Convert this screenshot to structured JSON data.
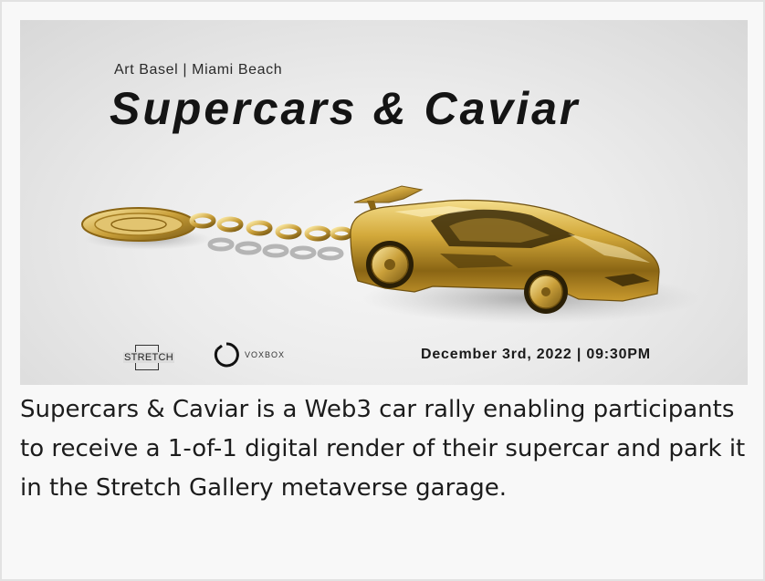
{
  "banner": {
    "subtitle": "Art Basel | Miami Beach",
    "title": "Supercars & Caviar",
    "logo_stretch": "STRETCH",
    "logo_voxbox": "VOXBOX",
    "date_time": "December 3rd, 2022 | 09:30PM",
    "image_subject": "gold supercar with gold keychain",
    "accent_color": "#c9a227"
  },
  "caption": {
    "text": "Supercars & Caviar is a Web3 car rally enabling participants to receive a 1-of-1 digital render of their supercar and park it in the Stretch Gallery metaverse garage."
  }
}
